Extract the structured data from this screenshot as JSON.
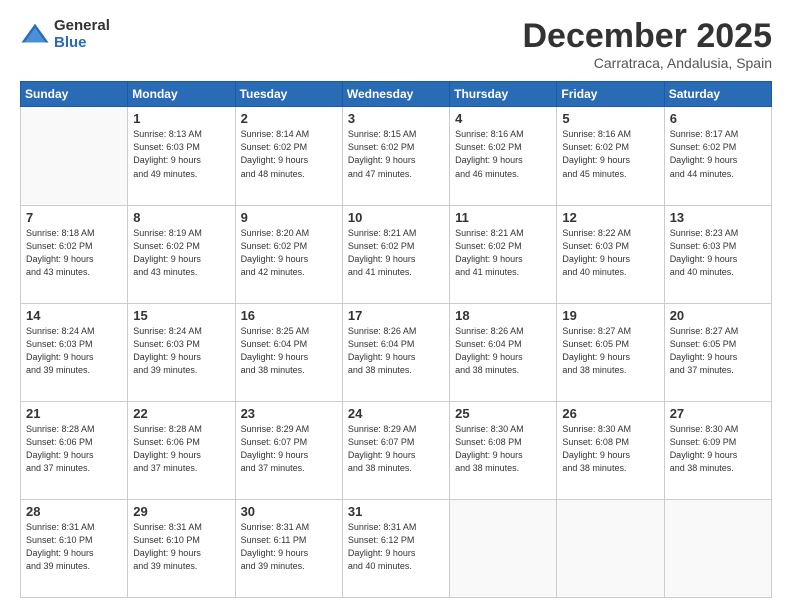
{
  "logo": {
    "general": "General",
    "blue": "Blue"
  },
  "header": {
    "month": "December 2025",
    "location": "Carratraca, Andalusia, Spain"
  },
  "days": [
    "Sunday",
    "Monday",
    "Tuesday",
    "Wednesday",
    "Thursday",
    "Friday",
    "Saturday"
  ],
  "weeks": [
    [
      {
        "day": "",
        "empty": true
      },
      {
        "day": "1",
        "sunrise": "8:13 AM",
        "sunset": "6:03 PM",
        "daylight": "9 hours and 49 minutes."
      },
      {
        "day": "2",
        "sunrise": "8:14 AM",
        "sunset": "6:02 PM",
        "daylight": "9 hours and 48 minutes."
      },
      {
        "day": "3",
        "sunrise": "8:15 AM",
        "sunset": "6:02 PM",
        "daylight": "9 hours and 47 minutes."
      },
      {
        "day": "4",
        "sunrise": "8:16 AM",
        "sunset": "6:02 PM",
        "daylight": "9 hours and 46 minutes."
      },
      {
        "day": "5",
        "sunrise": "8:16 AM",
        "sunset": "6:02 PM",
        "daylight": "9 hours and 45 minutes."
      },
      {
        "day": "6",
        "sunrise": "8:17 AM",
        "sunset": "6:02 PM",
        "daylight": "9 hours and 44 minutes."
      }
    ],
    [
      {
        "day": "7",
        "sunrise": "8:18 AM",
        "sunset": "6:02 PM",
        "daylight": "9 hours and 43 minutes."
      },
      {
        "day": "8",
        "sunrise": "8:19 AM",
        "sunset": "6:02 PM",
        "daylight": "9 hours and 43 minutes."
      },
      {
        "day": "9",
        "sunrise": "8:20 AM",
        "sunset": "6:02 PM",
        "daylight": "9 hours and 42 minutes."
      },
      {
        "day": "10",
        "sunrise": "8:21 AM",
        "sunset": "6:02 PM",
        "daylight": "9 hours and 41 minutes."
      },
      {
        "day": "11",
        "sunrise": "8:21 AM",
        "sunset": "6:02 PM",
        "daylight": "9 hours and 41 minutes."
      },
      {
        "day": "12",
        "sunrise": "8:22 AM",
        "sunset": "6:03 PM",
        "daylight": "9 hours and 40 minutes."
      },
      {
        "day": "13",
        "sunrise": "8:23 AM",
        "sunset": "6:03 PM",
        "daylight": "9 hours and 40 minutes."
      }
    ],
    [
      {
        "day": "14",
        "sunrise": "8:24 AM",
        "sunset": "6:03 PM",
        "daylight": "9 hours and 39 minutes."
      },
      {
        "day": "15",
        "sunrise": "8:24 AM",
        "sunset": "6:03 PM",
        "daylight": "9 hours and 39 minutes."
      },
      {
        "day": "16",
        "sunrise": "8:25 AM",
        "sunset": "6:04 PM",
        "daylight": "9 hours and 38 minutes."
      },
      {
        "day": "17",
        "sunrise": "8:26 AM",
        "sunset": "6:04 PM",
        "daylight": "9 hours and 38 minutes."
      },
      {
        "day": "18",
        "sunrise": "8:26 AM",
        "sunset": "6:04 PM",
        "daylight": "9 hours and 38 minutes."
      },
      {
        "day": "19",
        "sunrise": "8:27 AM",
        "sunset": "6:05 PM",
        "daylight": "9 hours and 38 minutes."
      },
      {
        "day": "20",
        "sunrise": "8:27 AM",
        "sunset": "6:05 PM",
        "daylight": "9 hours and 37 minutes."
      }
    ],
    [
      {
        "day": "21",
        "sunrise": "8:28 AM",
        "sunset": "6:06 PM",
        "daylight": "9 hours and 37 minutes."
      },
      {
        "day": "22",
        "sunrise": "8:28 AM",
        "sunset": "6:06 PM",
        "daylight": "9 hours and 37 minutes."
      },
      {
        "day": "23",
        "sunrise": "8:29 AM",
        "sunset": "6:07 PM",
        "daylight": "9 hours and 37 minutes."
      },
      {
        "day": "24",
        "sunrise": "8:29 AM",
        "sunset": "6:07 PM",
        "daylight": "9 hours and 38 minutes."
      },
      {
        "day": "25",
        "sunrise": "8:30 AM",
        "sunset": "6:08 PM",
        "daylight": "9 hours and 38 minutes."
      },
      {
        "day": "26",
        "sunrise": "8:30 AM",
        "sunset": "6:08 PM",
        "daylight": "9 hours and 38 minutes."
      },
      {
        "day": "27",
        "sunrise": "8:30 AM",
        "sunset": "6:09 PM",
        "daylight": "9 hours and 38 minutes."
      }
    ],
    [
      {
        "day": "28",
        "sunrise": "8:31 AM",
        "sunset": "6:10 PM",
        "daylight": "9 hours and 39 minutes."
      },
      {
        "day": "29",
        "sunrise": "8:31 AM",
        "sunset": "6:10 PM",
        "daylight": "9 hours and 39 minutes."
      },
      {
        "day": "30",
        "sunrise": "8:31 AM",
        "sunset": "6:11 PM",
        "daylight": "9 hours and 39 minutes."
      },
      {
        "day": "31",
        "sunrise": "8:31 AM",
        "sunset": "6:12 PM",
        "daylight": "9 hours and 40 minutes."
      },
      {
        "day": "",
        "empty": true
      },
      {
        "day": "",
        "empty": true
      },
      {
        "day": "",
        "empty": true
      }
    ]
  ]
}
